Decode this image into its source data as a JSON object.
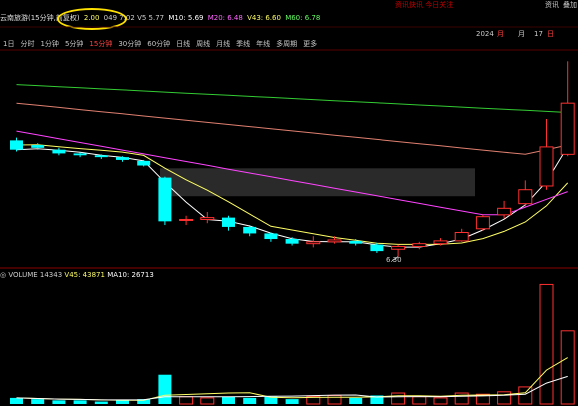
{
  "titlebar": {
    "notice": "资讯快讯 今日关注",
    "right_items": [
      "资讯",
      "叠加"
    ]
  },
  "header": {
    "stock_label": "云南旅游(15分钟,前复权)",
    "open": "2.00",
    "ma_items": [
      {
        "label": "M10: 5.69",
        "color": "#ffffff"
      },
      {
        "label": "M20: 6.48",
        "color": "#ff66ff"
      },
      {
        "label": "V43: 6.60",
        "color": "#ffff66"
      },
      {
        "label": "M60: 6.78",
        "color": "#66ff66"
      }
    ],
    "partial": "049  7.02  V5 5.77"
  },
  "date": {
    "year": "2024",
    "month": "月",
    "day": "17",
    "unit": "日"
  },
  "tabs": [
    "1日",
    "分时",
    "1分钟",
    "5分钟",
    "15分钟",
    "30分钟",
    "60分钟",
    "日线",
    "周线",
    "月线",
    "季线",
    "年线",
    "多周期",
    "更多"
  ],
  "active_tab": 4,
  "highlight_tabs": [
    3,
    4,
    5
  ],
  "min_label": "6.30",
  "volume": {
    "title": "VOLUME",
    "value": "14343",
    "v5_label": "V45: 43871",
    "ma10_label": "MA10: 26713"
  },
  "colors": {
    "up": "#ff3030",
    "down": "#00ffff",
    "bg": "#000000",
    "ma_white": "#ffffff",
    "ma_yellow": "#ffff66",
    "ma_pink": "#ff44ff",
    "ma_green": "#33cc33",
    "ma_salmon": "#e08070"
  },
  "chart_data": {
    "type": "candlestick",
    "series": [
      {
        "name": "K",
        "candles": [
          {
            "o": 7.55,
            "c": 7.45,
            "h": 7.58,
            "l": 7.43
          },
          {
            "o": 7.5,
            "c": 7.47,
            "h": 7.52,
            "l": 7.45
          },
          {
            "o": 7.45,
            "c": 7.41,
            "h": 7.47,
            "l": 7.39
          },
          {
            "o": 7.41,
            "c": 7.39,
            "h": 7.42,
            "l": 7.37
          },
          {
            "o": 7.39,
            "c": 7.37,
            "h": 7.4,
            "l": 7.35
          },
          {
            "o": 7.37,
            "c": 7.34,
            "h": 7.38,
            "l": 7.32
          },
          {
            "o": 7.33,
            "c": 7.28,
            "h": 7.34,
            "l": 7.27
          },
          {
            "o": 7.15,
            "c": 6.68,
            "h": 7.16,
            "l": 6.64
          },
          {
            "o": 6.7,
            "c": 6.7,
            "h": 6.74,
            "l": 6.64
          },
          {
            "o": 6.7,
            "c": 6.72,
            "h": 6.78,
            "l": 6.66
          },
          {
            "o": 6.72,
            "c": 6.62,
            "h": 6.74,
            "l": 6.58
          },
          {
            "o": 6.62,
            "c": 6.55,
            "h": 6.64,
            "l": 6.52
          },
          {
            "o": 6.55,
            "c": 6.49,
            "h": 6.56,
            "l": 6.46
          },
          {
            "o": 6.49,
            "c": 6.44,
            "h": 6.51,
            "l": 6.42
          },
          {
            "o": 6.44,
            "c": 6.46,
            "h": 6.52,
            "l": 6.4
          },
          {
            "o": 6.46,
            "c": 6.48,
            "h": 6.52,
            "l": 6.44
          },
          {
            "o": 6.47,
            "c": 6.44,
            "h": 6.49,
            "l": 6.42
          },
          {
            "o": 6.43,
            "c": 6.36,
            "h": 6.45,
            "l": 6.34
          },
          {
            "o": 6.38,
            "c": 6.41,
            "h": 6.43,
            "l": 6.3
          },
          {
            "o": 6.41,
            "c": 6.44,
            "h": 6.46,
            "l": 6.38
          },
          {
            "o": 6.44,
            "c": 6.47,
            "h": 6.5,
            "l": 6.42
          },
          {
            "o": 6.47,
            "c": 6.56,
            "h": 6.6,
            "l": 6.46
          },
          {
            "o": 6.6,
            "c": 6.73,
            "h": 6.75,
            "l": 6.58
          },
          {
            "o": 6.75,
            "c": 6.82,
            "h": 6.9,
            "l": 6.71
          },
          {
            "o": 6.87,
            "c": 7.02,
            "h": 7.12,
            "l": 6.84
          },
          {
            "o": 7.06,
            "c": 7.48,
            "h": 7.78,
            "l": 7.02
          },
          {
            "o": 7.4,
            "c": 7.95,
            "h": 8.4,
            "l": 7.38
          }
        ]
      }
    ],
    "volumes": [
      5,
      4,
      3,
      3,
      2,
      3,
      4,
      24,
      6,
      5,
      6,
      5,
      6,
      4,
      6,
      7,
      5,
      7,
      9,
      6,
      5,
      9,
      8,
      10,
      14,
      98,
      60
    ],
    "ylim": [
      6.2,
      8.5
    ],
    "vol_ylim": [
      0,
      100
    ]
  }
}
